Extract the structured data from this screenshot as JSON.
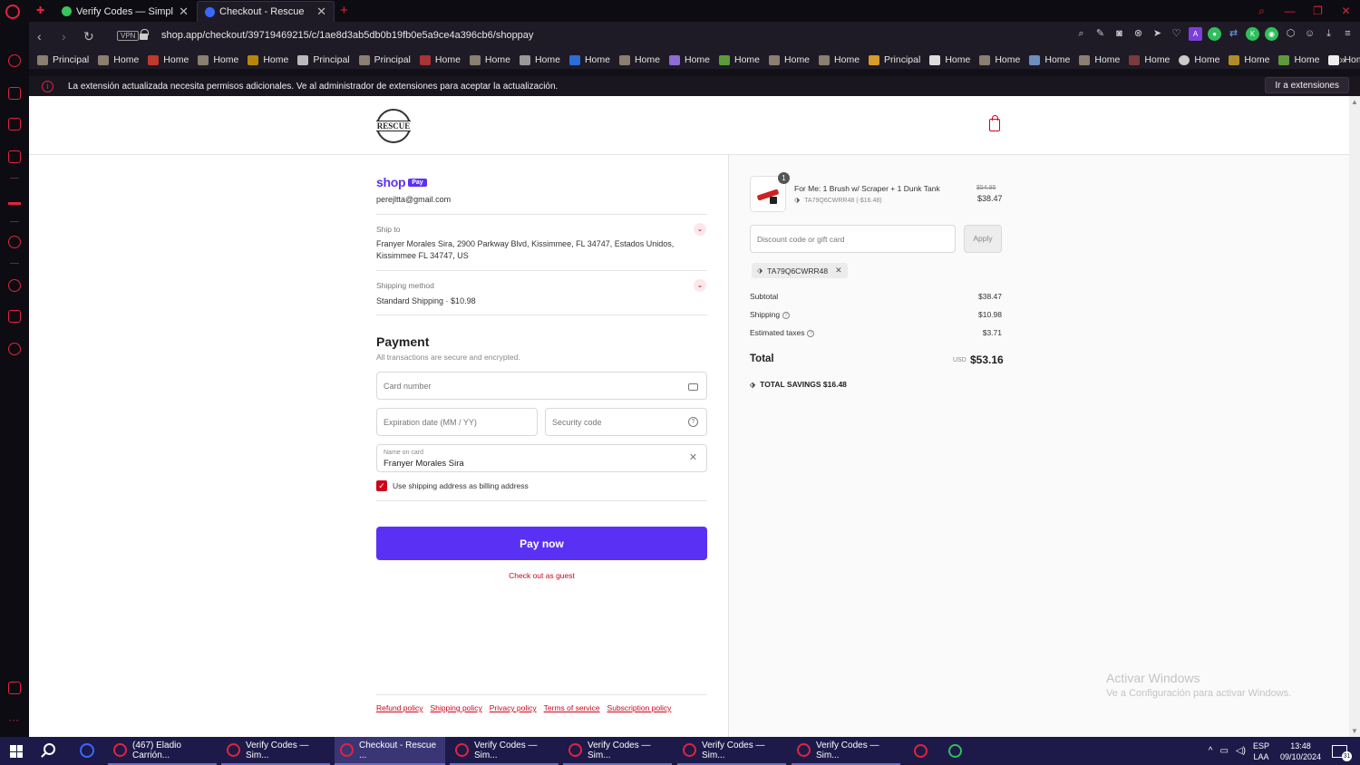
{
  "browser": {
    "tabs": [
      {
        "label": "Verify Codes — SimplyCod",
        "favicon_color": "#3ac45a"
      },
      {
        "label": "Checkout - Rescue",
        "favicon_color": "#3a68ff"
      }
    ],
    "new_tab_glyph": "+",
    "url": "shop.app/checkout/39719469215/c/1ae8d3ab5db0b19fb0e5a9ce4a396cb6/shoppay",
    "vpn_label": "VPN",
    "bookmarks": [
      "Principal",
      "Home",
      "Home",
      "Home",
      "Home",
      "Principal",
      "Principal",
      "Home",
      "Home",
      "Home",
      "Home",
      "Home",
      "Home",
      "Home",
      "Home",
      "Home",
      "Principal",
      "Home",
      "Home",
      "Home",
      "Home",
      "Home",
      "Home",
      "Home",
      "Home",
      "Home"
    ],
    "info_message": "La extensión actualizada necesita permisos adicionales. Ve al administrador de extensiones para aceptar la actualización.",
    "info_button": "Ir a extensiones"
  },
  "checkout": {
    "store_logo_text": "RESCUE",
    "shop_pay": {
      "word": "shop",
      "pill": "Pay"
    },
    "email": "perejltta@gmail.com",
    "ship_to": {
      "label": "Ship to",
      "value": "Franyer Morales Sira, 2900 Parkway Blvd, Kissimmee, FL 34747, Estados Unidos, Kissimmee FL 34747, US"
    },
    "shipping_method": {
      "label": "Shipping method",
      "value": "Standard Shipping · $10.98"
    },
    "payment": {
      "title": "Payment",
      "subtitle": "All transactions are secure and encrypted.",
      "card_number_placeholder": "Card number",
      "expiration_placeholder": "Expiration date (MM / YY)",
      "security_placeholder": "Security code",
      "name_label": "Name on card",
      "name_value": "Franyer Morales Sira",
      "billing_checkbox_label": "Use shipping address as billing address",
      "billing_checked": true
    },
    "pay_button": "Pay now",
    "guest_link": "Check out as guest",
    "footer_links": [
      "Refund policy",
      "Shipping policy",
      "Privacy policy",
      "Terms of service",
      "Subscription policy"
    ]
  },
  "summary": {
    "item": {
      "quantity": "1",
      "name": "For Me: 1 Brush w/ Scraper + 1 Dunk Tank",
      "discount_line": "TA79Q6CWRR48 (-$16.48)",
      "original_price": "$54.95",
      "price": "$38.47"
    },
    "discount_placeholder": "Discount code or gift card",
    "apply_label": "Apply",
    "applied_code": "TA79Q6CWRR48",
    "lines": [
      {
        "label": "Subtotal",
        "value": "$38.47",
        "help": false
      },
      {
        "label": "Shipping",
        "value": "$10.98",
        "help": true
      },
      {
        "label": "Estimated taxes",
        "value": "$3.71",
        "help": true
      }
    ],
    "total_label": "Total",
    "total_currency": "USD",
    "total_value": "$53.16",
    "savings": "TOTAL SAVINGS  $16.48"
  },
  "windows_watermark": {
    "line1": "Activar Windows",
    "line2": "Ve a Configuración para activar Windows."
  },
  "taskbar": {
    "tasks": [
      {
        "label": "(467) Eladio Carrión...",
        "active": false
      },
      {
        "label": "Verify Codes — Sim...",
        "active": false
      },
      {
        "label": "Checkout - Rescue ...",
        "active": true
      },
      {
        "label": "Verify Codes — Sim...",
        "active": false
      },
      {
        "label": "Verify Codes — Sim...",
        "active": false
      },
      {
        "label": "Verify Codes — Sim...",
        "active": false
      },
      {
        "label": "Verify Codes — Sim...",
        "active": false
      }
    ],
    "lang_top": "ESP",
    "lang_bottom": "LAA",
    "time": "13:48",
    "date": "09/10/2024",
    "notifications": "31"
  },
  "colors": {
    "accent_red": "#d0021b",
    "shop_pay_purple": "#5a31f4",
    "opera_red": "#e0243c",
    "taskbar": "#1d1a4a"
  }
}
